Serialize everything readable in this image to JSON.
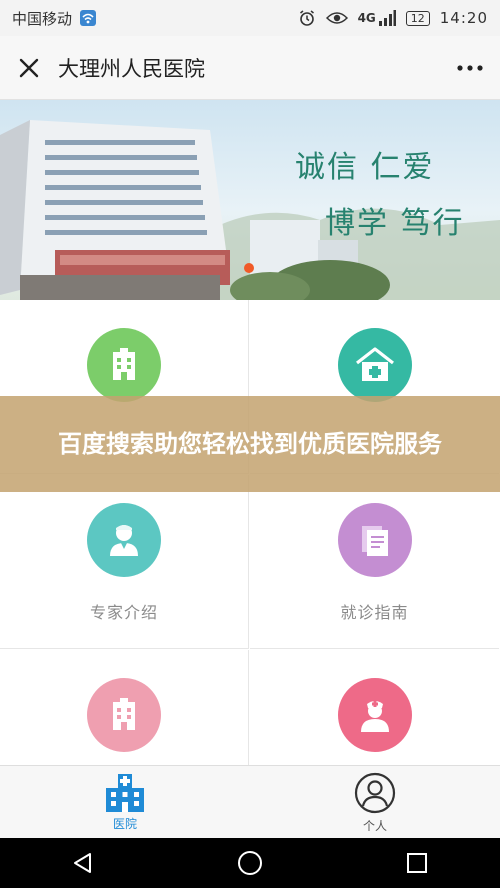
{
  "status_bar": {
    "carrier": "中国移动",
    "network": "4G",
    "battery": "12",
    "time": "14:20"
  },
  "app_bar": {
    "title": "大理州人民医院"
  },
  "banner": {
    "slogan_line1": "诚信  仁爱",
    "slogan_line2": "博学  笃行"
  },
  "grid": {
    "items": [
      {
        "label": "",
        "icon": "hospital-building-icon",
        "color": "#7ccd6a"
      },
      {
        "label": "",
        "icon": "medical-house-icon",
        "color": "#35b9a3"
      },
      {
        "label": "专家介绍",
        "icon": "doctor-icon",
        "color": "#5cc7c2"
      },
      {
        "label": "就诊指南",
        "icon": "document-icon",
        "color": "#c48ed2"
      },
      {
        "label": "",
        "icon": "hospital-building-icon",
        "color": "#ef9fb0"
      },
      {
        "label": "",
        "icon": "nurse-icon",
        "color": "#ee6a88"
      }
    ]
  },
  "overlay": {
    "text": "百度搜索助您轻松找到优质医院服务"
  },
  "tab_bar": {
    "tabs": [
      {
        "label": "医院",
        "icon": "hospital-icon",
        "active": true
      },
      {
        "label": "个人",
        "icon": "person-icon",
        "active": false
      }
    ]
  },
  "colors": {
    "accent_blue": "#1f8bd6",
    "slogan_green": "#27826f",
    "overlay": "#c4a370"
  }
}
